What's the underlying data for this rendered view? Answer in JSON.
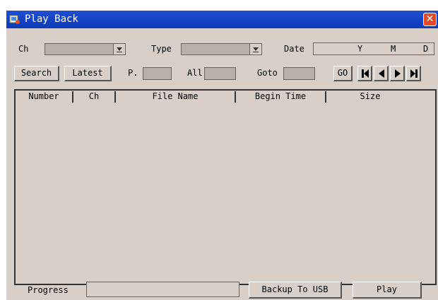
{
  "window": {
    "title": "Play Back",
    "close_glyph": "✕"
  },
  "filters": {
    "ch_label": "Ch",
    "type_label": "Type",
    "date_label": "Date",
    "date_y": "Y",
    "date_m": "M",
    "date_d": "D"
  },
  "toolbar": {
    "search_label": "Search",
    "latest_label": "Latest",
    "page_label": "P.",
    "all_label": "All",
    "goto_label": "Goto",
    "go_label": "GO"
  },
  "list": {
    "columns": [
      "Number",
      "Ch",
      "File Name",
      "Begin Time",
      "Size"
    ],
    "rows": []
  },
  "footer": {
    "progress_label": "Progress",
    "backup_label": "Backup To USB",
    "play_label": "Play"
  },
  "icons": [
    "app-icon",
    "close-icon",
    "dropdown-arrow-icon",
    "first-page-icon",
    "prev-page-icon",
    "next-page-icon",
    "last-page-icon"
  ],
  "colors": {
    "titlebar": "#0a3ab8",
    "panel": "#d8d0c8",
    "close": "#e04a2a"
  }
}
